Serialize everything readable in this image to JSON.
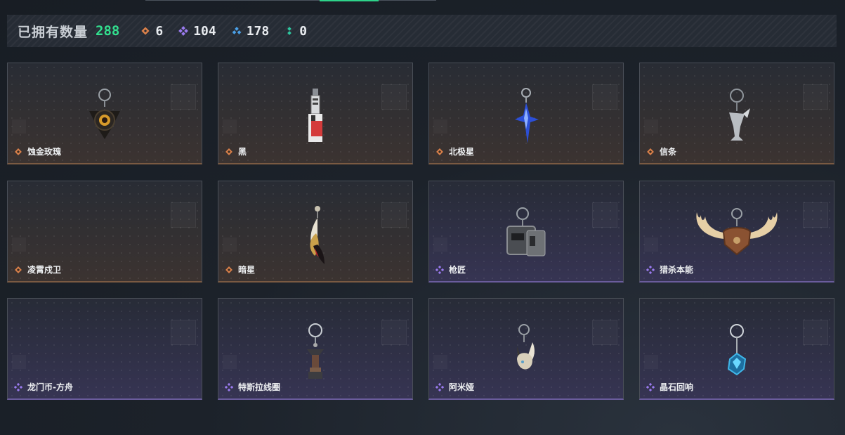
{
  "header": {
    "owned_label": "已拥有数量",
    "owned_count": "288",
    "stats": [
      {
        "icon": "orange-diamond-icon",
        "color": "#d9804a",
        "value": "6"
      },
      {
        "icon": "purple-diamond-icon",
        "color": "#9b7bf0",
        "value": "104"
      },
      {
        "icon": "blue-diamond-icon",
        "color": "#4aa0e8",
        "value": "178"
      },
      {
        "icon": "teal-dots-icon",
        "color": "#2ec7a0",
        "value": "0"
      }
    ]
  },
  "colors": {
    "accent_green": "#32e08f",
    "rarity_orange": "#d9804a",
    "rarity_purple": "#9b7bf0"
  },
  "items": [
    {
      "name": "蚀金玫瑰",
      "rarity": "orange",
      "icon": "rose-charm-icon"
    },
    {
      "name": "黑",
      "rarity": "orange",
      "icon": "tag-charm-icon"
    },
    {
      "name": "北极星",
      "rarity": "orange",
      "icon": "star-charm-icon"
    },
    {
      "name": "信条",
      "rarity": "orange",
      "icon": "creed-charm-icon"
    },
    {
      "name": "凌霄戍卫",
      "rarity": "orange",
      "icon": "empty-charm-icon"
    },
    {
      "name": "暗星",
      "rarity": "orange",
      "icon": "feather-charm-icon"
    },
    {
      "name": "枪匠",
      "rarity": "purple",
      "icon": "dogtag-charm-icon"
    },
    {
      "name": "猎杀本能",
      "rarity": "purple",
      "icon": "antler-charm-icon"
    },
    {
      "name": "龙门币-方舟",
      "rarity": "purple",
      "icon": "empty-charm-icon"
    },
    {
      "name": "特斯拉线圈",
      "rarity": "purple",
      "icon": "tesla-coil-charm-icon"
    },
    {
      "name": "阿米娅",
      "rarity": "purple",
      "icon": "bunny-charm-icon"
    },
    {
      "name": "晶石回响",
      "rarity": "purple",
      "icon": "crystal-charm-icon"
    }
  ]
}
